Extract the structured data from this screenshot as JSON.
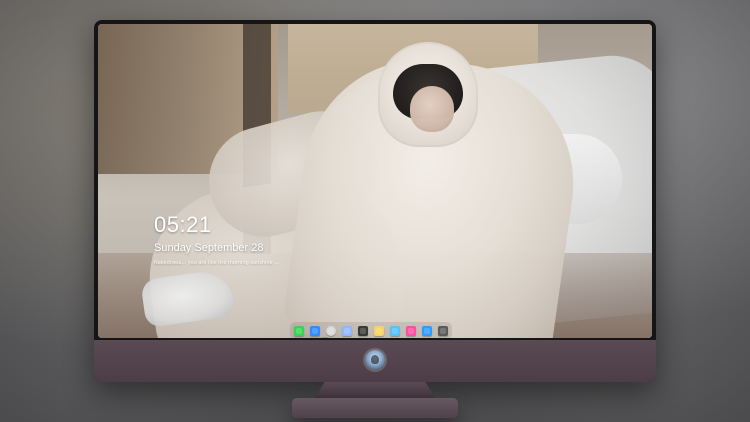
{
  "lock_screen": {
    "time": "05:21",
    "date": "Sunday September  28",
    "subtext": "Nakedness...  you are like the morning sunshine ..."
  },
  "dock": {
    "items": [
      {
        "name": "messages-app-icon",
        "color": "#39d353"
      },
      {
        "name": "finder-app-icon",
        "color": "#2f8cff"
      },
      {
        "name": "settings-app-icon",
        "color": "#d8d8d8"
      },
      {
        "name": "preview-app-icon",
        "color": "#8fb6ff"
      },
      {
        "name": "clapper-app-icon",
        "color": "#3a3a3a"
      },
      {
        "name": "notes-app-icon",
        "color": "#f6d365"
      },
      {
        "name": "photos-app-icon",
        "color": "#55c1ff"
      },
      {
        "name": "music-app-icon",
        "color": "#ff4fa3"
      },
      {
        "name": "app-store-app-icon",
        "color": "#2d9cff"
      },
      {
        "name": "camera-app-icon",
        "color": "#5b5b5b"
      }
    ]
  }
}
